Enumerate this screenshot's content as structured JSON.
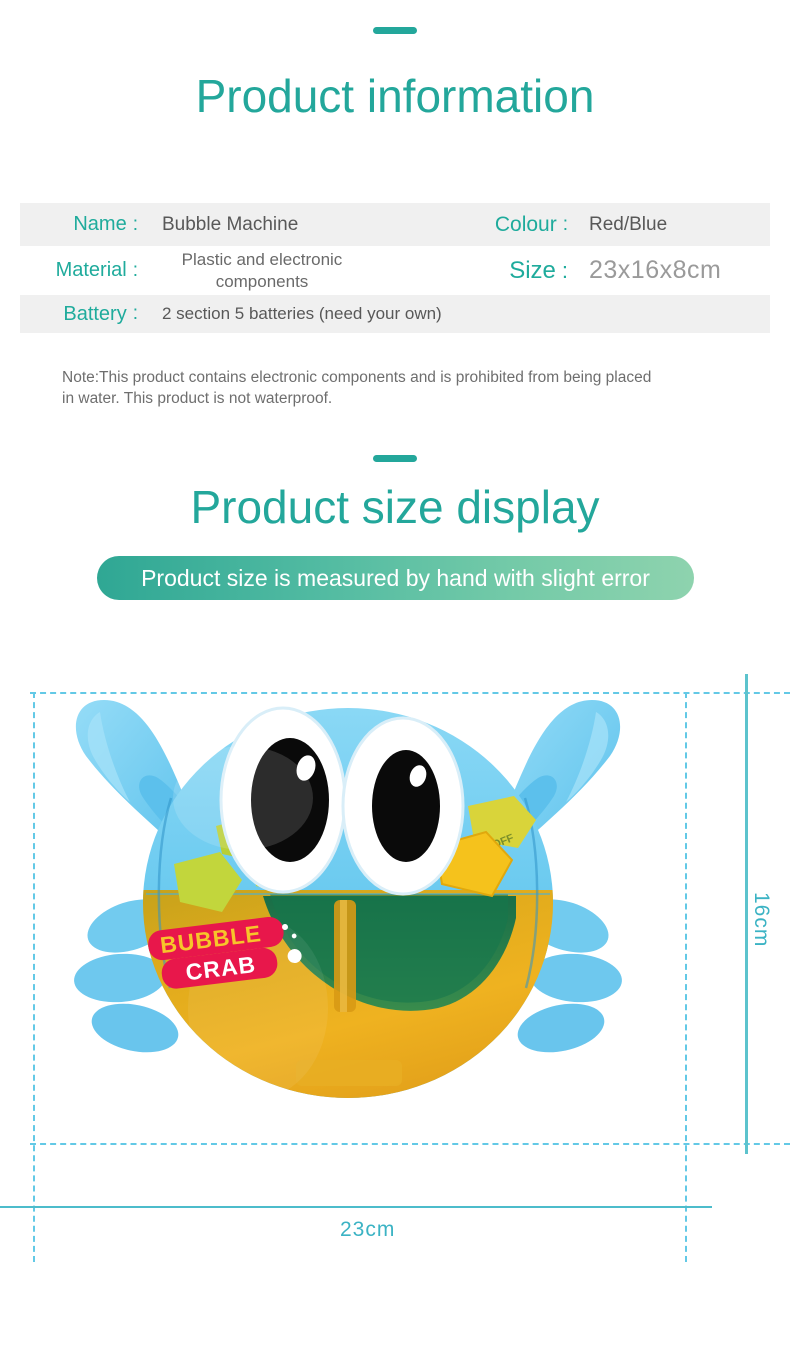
{
  "headings": {
    "product_info": "Product information",
    "size_display": "Product size display"
  },
  "spec_table": {
    "rows": [
      {
        "left_label": "Name",
        "left_colon": ":",
        "left_value": "Bubble Machine",
        "right_label": "Colour",
        "right_colon": ":",
        "right_value": "Red/Blue"
      },
      {
        "left_label": "Material",
        "left_colon": ":",
        "left_value": "Plastic and electronic components",
        "right_label": "Size",
        "right_colon": ":",
        "right_value": "23x16x8cm"
      },
      {
        "left_label": "Battery",
        "left_colon": ":",
        "left_value": "2 section 5 batteries (need your own)",
        "right_label": "",
        "right_colon": "",
        "right_value": ""
      }
    ]
  },
  "note": "Note:This product contains electronic components and is prohibited from being placed in water. This product is not waterproof.",
  "banner": {
    "text": "Product size is measured by hand with slight error",
    "gradient_start": "#2fa794",
    "gradient_end": "#8ed3ae"
  },
  "dimensions": {
    "height_label": "16cm",
    "width_label": "23cm",
    "guide_color": "#63c9e6",
    "axis_color": "#4cbccb"
  },
  "product": {
    "brand_line1": "BUBBLE",
    "brand_line2": "CRAB",
    "power_label": "ON/OFF",
    "body_color": "#6ecbf0",
    "tank_color": "#e9a821"
  },
  "theme": {
    "accent": "#23a79b",
    "label": "#1fab9c",
    "value": "#585858",
    "row_shade": "#f0f0f0"
  }
}
